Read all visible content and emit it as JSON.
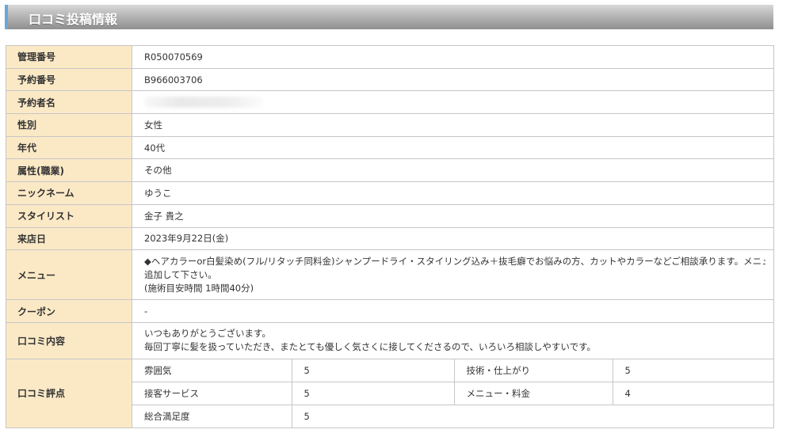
{
  "header": {
    "title": "口コミ投稿情報"
  },
  "fields": {
    "management_no": {
      "label": "管理番号",
      "value": "R050070569"
    },
    "reservation_no": {
      "label": "予約番号",
      "value": "B966003706"
    },
    "reserver_name": {
      "label": "予約者名",
      "value": ""
    },
    "gender": {
      "label": "性別",
      "value": "女性"
    },
    "age": {
      "label": "年代",
      "value": "40代"
    },
    "occupation": {
      "label": "属性(職業)",
      "value": "その他"
    },
    "nickname": {
      "label": "ニックネーム",
      "value": "ゆうこ"
    },
    "stylist": {
      "label": "スタイリスト",
      "value": "金子 貴之"
    },
    "visit_date": {
      "label": "来店日",
      "value": "2023年9月22日(金)"
    },
    "menu": {
      "label": "メニュー",
      "line1": "◆ヘアカラーor白髪染め(フル/リタッチ同料金)シャンプードライ・スタイリング込み＋抜毛癖でお悩みの方、カットやカラーなどご相談承ります。メニューに",
      "line2": "追加して下さい。",
      "line3": "(施術目安時間 1時間40分)"
    },
    "coupon": {
      "label": "クーポン",
      "value": "-"
    },
    "review": {
      "label": "口コミ内容",
      "line1": "いつもありがとうございます。",
      "line2": "毎回丁寧に髪を扱っていただき、またとても優しく気さくに接してくださるので、いろいろ相談しやすいです。"
    },
    "rating": {
      "label": "口コミ評点",
      "items": [
        {
          "name": "雰囲気",
          "value": "5"
        },
        {
          "name": "技術・仕上がり",
          "value": "5"
        },
        {
          "name": "接客サービス",
          "value": "5"
        },
        {
          "name": "メニュー・料金",
          "value": "4"
        },
        {
          "name": "総合満足度",
          "value": "5"
        }
      ]
    }
  },
  "colors": {
    "label_bg": "#fbe9c6",
    "border": "#c6c6c6",
    "title_accent": "#6aa7d8"
  }
}
